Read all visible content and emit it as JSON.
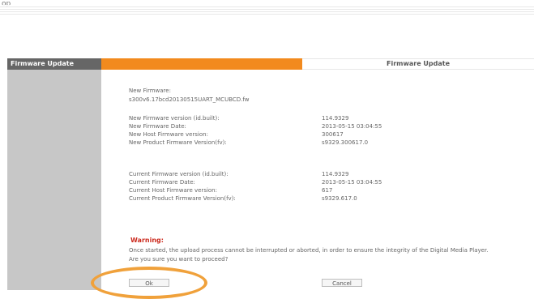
{
  "header": {
    "top_text": "op"
  },
  "sidebar": {
    "title": "Firmware Update"
  },
  "tab": {
    "title": "Firmware Update"
  },
  "new": {
    "firmware_label": "New Firmware:",
    "firmware_file": "s300v6.17bcd20130515UART_MCUBCD.fw",
    "rows": [
      {
        "label": "New Firmware version (id.built):",
        "value": "114.9329"
      },
      {
        "label": "New Firmware Date:",
        "value": "2013-05-15  03:04:55"
      },
      {
        "label": "New Host Firmware version:",
        "value": "300617"
      },
      {
        "label": "New Product Firmware Version(fv):",
        "value": "s9329.300617.0"
      }
    ]
  },
  "current": {
    "rows": [
      {
        "label": "Current Firmware version (id.built):",
        "value": "114.9329"
      },
      {
        "label": "Current Firmware Date:",
        "value": "2013-05-15  03:04:55"
      },
      {
        "label": "Current Host Firmware version:",
        "value": "617"
      },
      {
        "label": "Current Product Firmware Version(fv):",
        "value": "s9329.617.0"
      }
    ]
  },
  "warning": {
    "title": "Warning:",
    "line1": "Once started, the upload process cannot be interrupted or aborted, in order to ensure the integrity of the Digital Media Player.",
    "line2": "Are you sure you want to proceed?"
  },
  "buttons": {
    "ok": "Ok",
    "cancel": "Cancel"
  },
  "colors": {
    "orange": "#f28a1e",
    "sidebar": "#c7c7c7",
    "sidebar_header": "#666666",
    "warning": "#cc2b1f",
    "highlight": "#f0a13b"
  }
}
